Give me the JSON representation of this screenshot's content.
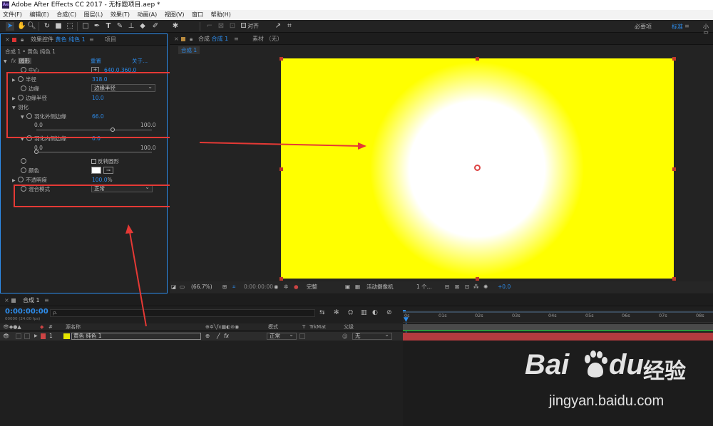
{
  "app": {
    "title": "Adobe After Effects CC 2017 - 无标题项目.aep *",
    "icon_label": "Ae"
  },
  "menu": [
    "文件(F)",
    "编辑(E)",
    "合成(C)",
    "图层(L)",
    "效果(T)",
    "动画(A)",
    "视图(V)",
    "窗口",
    "帮助(H)"
  ],
  "toolbar": {
    "align_label": "对齐",
    "workspaces": [
      "必要项",
      "标准",
      "小屏"
    ],
    "active_workspace": "标准"
  },
  "effect_panel": {
    "tab_label": "效果控件",
    "layer_name": "黄色 纯色 1",
    "other_tab": "项目",
    "breadcrumb": "合成 1 • 黄色 纯色 1",
    "effect_name": "圆形",
    "reset_label": "重置",
    "about_label": "关于...",
    "center_label": "中心",
    "center_value": "640.0,360.0",
    "radius_label": "半径",
    "radius_value": "318.0",
    "edge_label": "边缘",
    "edge_value": "边缘半径",
    "edge_radius_label": "边缘半径",
    "edge_radius_value": "10.0",
    "feather_label": "羽化",
    "feather_outer_label": "羽化外侧边缘",
    "feather_outer_value": "66.0",
    "slider_min": "0.0",
    "slider_max": "100.0",
    "feather_outer_fraction": 0.66,
    "feather_inner_label": "羽化内侧边缘",
    "feather_inner_value": "0.0",
    "feather_inner_fraction": 0.0,
    "invert_label": "反转圆形",
    "color_label": "颜色",
    "opacity_label": "不透明度",
    "opacity_value": "100.0",
    "opacity_unit": "%",
    "blend_label": "混合模式",
    "blend_value": "正常"
  },
  "comp_panel": {
    "tab_label": "合成",
    "comp_name": "合成 1",
    "footage_label": "素材 （无）",
    "sub_tab": "合成 1",
    "zoom": "(66.7%)",
    "timecode": "0:00:00:00",
    "resolution": "完整",
    "camera": "活动摄像机",
    "views": "1 个...",
    "exposure": "+0.0",
    "colors": {
      "solid": "#ffff00",
      "circle": "#ffffff"
    }
  },
  "timeline": {
    "tab_label": "合成 1",
    "timecode": "0:00:00:00",
    "fps_info": "00000 (24.00 fps)",
    "search_placeholder": "ρ.",
    "columns": {
      "index": "#",
      "source": "源名称",
      "mode": "模式",
      "t": "T",
      "trkmat": "TrkMat",
      "parent": "父级"
    },
    "layer": {
      "index": "1",
      "name": "黄色 纯色 1",
      "mode": "正常",
      "parent": "无",
      "color": "#e6e600"
    },
    "ruler": [
      "0s",
      "01s",
      "02s",
      "03s",
      "04s",
      "05s",
      "06s",
      "07s",
      "08s"
    ]
  },
  "watermark": {
    "brand": "Bai",
    "brand2": "du",
    "cn": "经验",
    "url": "jingyan.baidu.com"
  }
}
